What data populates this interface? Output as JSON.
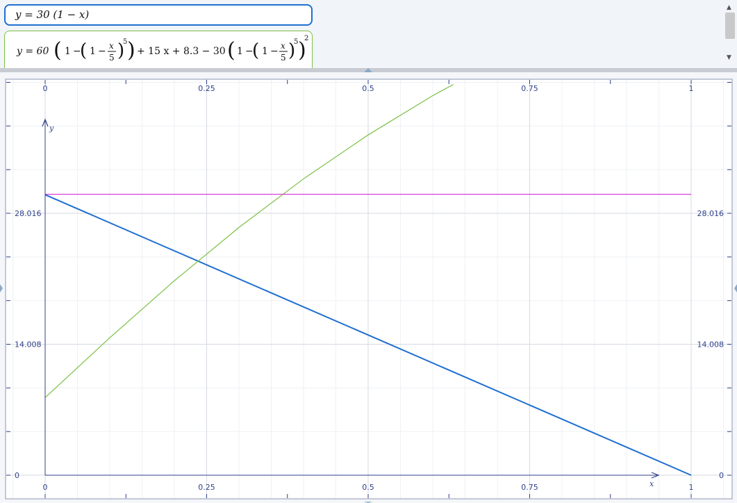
{
  "expressions": {
    "expr1": {
      "text": "y = 30 (1 − x)",
      "color": "#1f6fd0"
    },
    "expr2": {
      "lhs": "y = 60",
      "one": "1",
      "minus": "−",
      "x": "x",
      "five": "5",
      "exp5": "5",
      "exp2": "2",
      "mid": "+ 15 x + 8.3 − 30",
      "color": "#7bc043"
    }
  },
  "chart_data": {
    "type": "line",
    "x_ticks": [
      "0",
      "0.25",
      "0.5",
      "0.75",
      "1"
    ],
    "y_ticks": [
      "0",
      "14.008",
      "28.016"
    ],
    "xlabel": "x",
    "ylabel": "y",
    "xlim": [
      0,
      1
    ],
    "ylim": [
      0,
      28.016
    ],
    "grid": true,
    "series": [
      {
        "expr": "30 (1 − x)",
        "color": "#1f6fd0",
        "x": [
          0,
          1
        ],
        "y": [
          30,
          0
        ]
      },
      {
        "expr": "60 (1 − (1 − x/5)^5) + 15 x + 8.3 − 30 (1 − (1 − x/5)^5)^2",
        "color": "#7bc043",
        "x": [
          0,
          0.1,
          0.2,
          0.3,
          0.4,
          0.5,
          0.6,
          0.632
        ],
        "y": [
          8.3,
          14.7,
          20.8,
          26.5,
          31.7,
          36.4,
          40.6,
          41.8
        ]
      },
      {
        "color": "#d640d6",
        "x": [
          0,
          1
        ],
        "y": [
          30.05,
          30.05
        ]
      }
    ]
  }
}
